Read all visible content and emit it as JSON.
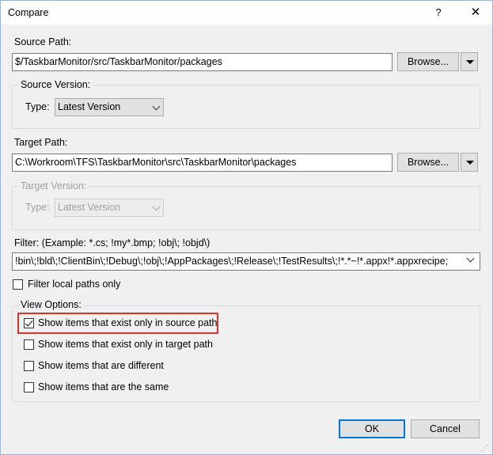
{
  "window": {
    "title": "Compare",
    "help": "?",
    "close": "✕"
  },
  "source": {
    "path_label": "Source Path:",
    "path_value": "$/TaskbarMonitor/src/TaskbarMonitor/packages",
    "browse_label": "Browse...",
    "version_group": "Source Version:",
    "type_label": "Type:",
    "type_value": "Latest Version"
  },
  "target": {
    "path_label": "Target Path:",
    "path_value": "C:\\Workroom\\TFS\\TaskbarMonitor\\src\\TaskbarMonitor\\packages",
    "browse_label": "Browse...",
    "version_group": "Target Version:",
    "type_label": "Type:",
    "type_value": "Latest Version"
  },
  "filter": {
    "label": "Filter:  (Example: *.cs; !my*.bmp; !obj\\; !objd\\)",
    "value": "!bin\\;!bld\\;!ClientBin\\;!Debug\\;!obj\\;!AppPackages\\;!Release\\;!TestResults\\;!*.*~!*.appx!*.appxrecipe;"
  },
  "filter_local": {
    "label": "Filter local paths only",
    "checked": false
  },
  "view_options": {
    "group_label": "View Options:",
    "items": [
      {
        "label": "Show items that exist only in source path",
        "checked": true
      },
      {
        "label": "Show items that exist only in target path",
        "checked": false
      },
      {
        "label": "Show items that are different",
        "checked": false
      },
      {
        "label": "Show items that are the same",
        "checked": false
      }
    ]
  },
  "buttons": {
    "ok": "OK",
    "cancel": "Cancel"
  },
  "colors": {
    "highlight": "#d9362b",
    "accent": "#0078d7"
  }
}
